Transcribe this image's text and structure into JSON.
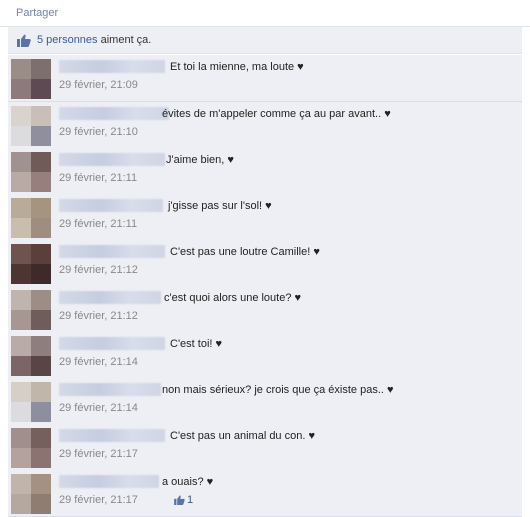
{
  "share": {
    "label": "Partager"
  },
  "likes": {
    "count_label": "5 personnes",
    "suffix": " aiment ça."
  },
  "colors": {
    "accent": "#3b5998",
    "panel": "#edeff4",
    "border": "#dfe3ee"
  },
  "comments": [
    {
      "text": "Et toi la mienne, ma loute ♥",
      "time": "29 février, 21:09"
    },
    {
      "text": "évites de m'appeler comme ça au par avant.. ♥",
      "time": "29 février, 21:10"
    },
    {
      "text": "J'aime bien, ♥",
      "time": "29 février, 21:11"
    },
    {
      "text": "j'gisse pas sur l'sol! ♥",
      "time": "29 février, 21:11"
    },
    {
      "text": "C'est pas une loutre Camille! ♥",
      "time": "29 février, 21:12"
    },
    {
      "text": "c'est quoi alors une loute? ♥",
      "time": "29 février, 21:12"
    },
    {
      "text": "C'est toi! ♥",
      "time": "29 février, 21:14"
    },
    {
      "text": "non mais sérieux? je crois que ça éxiste pas.. ♥",
      "time": "29 février, 21:14"
    },
    {
      "text": "C'est pas un animal du con. ♥",
      "time": "29 février, 21:17"
    },
    {
      "text": "a ouais? ♥",
      "time": "29 février, 21:17",
      "likes": "1"
    }
  ]
}
